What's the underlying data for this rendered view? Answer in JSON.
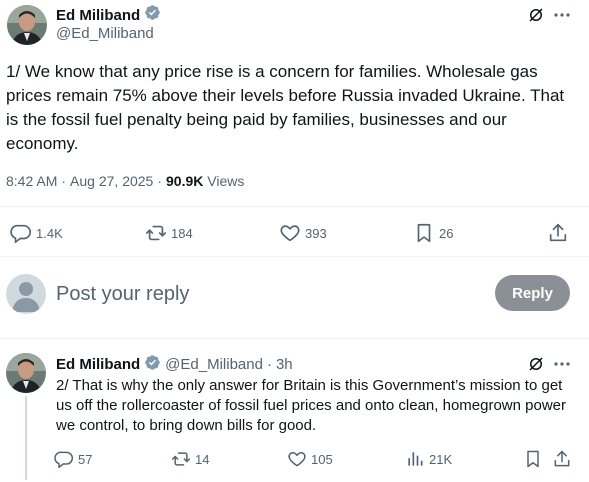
{
  "main_tweet": {
    "author_name": "Ed Miliband",
    "author_handle": "@Ed_Miliband",
    "text": "1/ We know that any price rise is a concern for families. Wholesale gas prices remain 75% above their levels before Russia invaded Ukraine. That is the fossil fuel penalty being paid by families, businesses and our economy.",
    "time": "8:42 AM",
    "date": "Aug 27, 2025",
    "views_count": "90.9K",
    "views_label": "Views",
    "replies": "1.4K",
    "reposts": "184",
    "likes": "393",
    "bookmarks": "26"
  },
  "composer": {
    "placeholder": "Post your reply",
    "button_label": "Reply"
  },
  "reply_tweet": {
    "author_name": "Ed Miliband",
    "author_handle": "@Ed_Miliband",
    "age": "3h",
    "text": "2/ That is why the only answer for Britain is this Government’s mission to get us off the rollercoaster of fossil fuel prices and onto clean, homegrown power we control, to bring down bills for good.",
    "replies": "57",
    "reposts": "14",
    "likes": "105",
    "views": "21K"
  },
  "colors": {
    "verified": "#829aab",
    "text_primary": "#0f1419",
    "text_muted": "#536471",
    "reply_button": "#8b9096"
  },
  "icons": [
    "grok-icon",
    "more-icon",
    "reply-icon",
    "repost-icon",
    "like-icon",
    "bookmark-icon",
    "share-icon",
    "views-icon",
    "verified-badge-icon"
  ]
}
